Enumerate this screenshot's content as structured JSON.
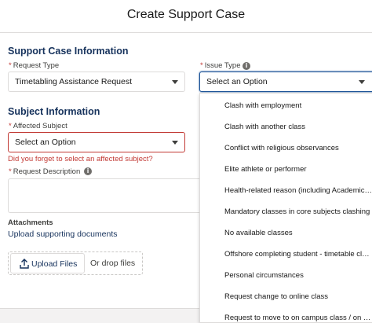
{
  "modal": {
    "title": "Create Support Case"
  },
  "case_info": {
    "title": "Support Case Information",
    "request_type": {
      "label": "Request Type",
      "value": "Timetabling Assistance Request"
    },
    "issue_type": {
      "label": "Issue Type",
      "placeholder": "Select an Option"
    }
  },
  "subject_info": {
    "title": "Subject Information",
    "affected_subject": {
      "label": "Affected Subject",
      "placeholder": "Select an Option",
      "error": "Did you forget to select an affected subject?"
    },
    "request_description": {
      "label": "Request Description",
      "value": ""
    }
  },
  "attachments": {
    "label": "Attachments",
    "upload_link": "Upload supporting documents",
    "upload_button": "Upload Files",
    "drop_text": "Or drop files"
  },
  "issue_type_options": [
    "Clash with employment",
    "Clash with another class",
    "Conflict with religious observances",
    "Elite athlete or performer",
    "Health-related reason (including Academic Adjustment Plan)",
    "Mandatory classes in core subjects clashing",
    "No available classes",
    "Offshore completing student - timetable clash",
    "Personal circumstances",
    "Request change to online class",
    "Request to move to on campus class / on campus activity"
  ],
  "required_marker": "*",
  "info_glyph": "i",
  "colors": {
    "heading": "#16325c",
    "error": "#c23934",
    "focus_border": "#1b5297",
    "border": "#dddbda"
  }
}
